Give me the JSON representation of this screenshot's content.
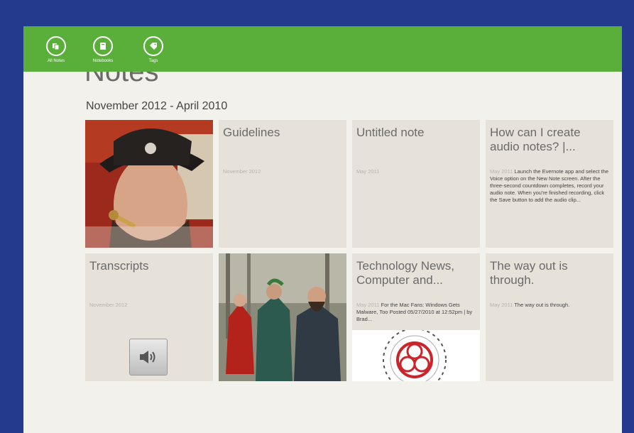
{
  "appbar": {
    "buttons": [
      {
        "label": "All Notes",
        "icon": "all-notes-icon"
      },
      {
        "label": "Notebooks",
        "icon": "notebook-icon"
      },
      {
        "label": "Tags",
        "icon": "tag-icon"
      }
    ]
  },
  "page": {
    "title": "Notes",
    "section": "November 2012 - April 2010"
  },
  "notes": [
    {
      "type": "photo",
      "image": "pirate-portrait"
    },
    {
      "title": "Guidelines",
      "date": "November 2012",
      "snippet": ""
    },
    {
      "title": "Untitled note",
      "date": "May 2011",
      "snippet": ""
    },
    {
      "title": "How can I create audio notes? |...",
      "date": "May 2011",
      "snippet": "Launch the Evernote app and select the Voice option on the New Note screen. After the three-second countdown completes, record your audio note. When you're finished recording, click the Save button to add the audio clip..."
    },
    {
      "title": "Transcripts",
      "date": "November 2012",
      "snippet": "",
      "attachment": "speaker-icon"
    },
    {
      "type": "photo",
      "image": "costume-group"
    },
    {
      "title": "Technology News, Computer and...",
      "date": "May 2011",
      "snippet": "For the Mac Fans: Windows Gets Malware, Too Posted 05/27/2010 at 12:52pm | by Brad...",
      "image": "biohazard-symbol"
    },
    {
      "title": "The way out is through.",
      "date": "May 2011",
      "snippet": "The way out is through."
    }
  ],
  "colors": {
    "outer_bg": "#243a8c",
    "appbar": "#5aae3a",
    "canvas": "#f3f1ec",
    "tile": "#e6e1d9"
  }
}
